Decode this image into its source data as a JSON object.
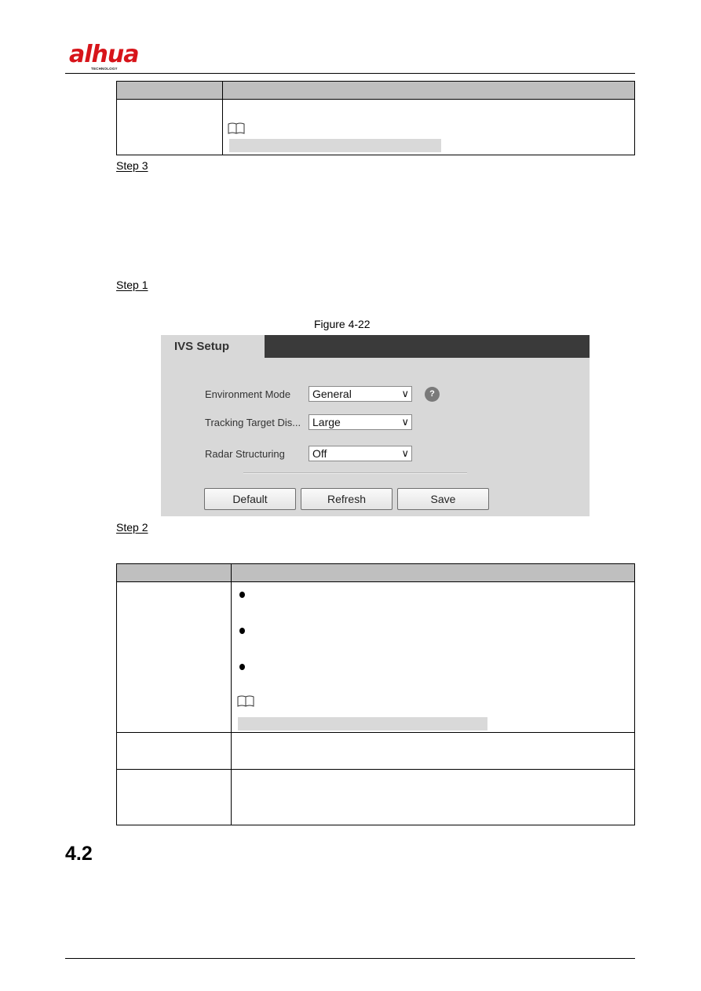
{
  "header": {
    "logo_text": "alhua",
    "logo_tagline": "TECHNOLOGY",
    "brand_color": "#d7141a"
  },
  "steps": {
    "step3": "Step 3",
    "step1": "Step 1",
    "step2": "Step 2"
  },
  "figure": {
    "caption": "Figure 4-22",
    "panel": {
      "tab_title": "IVS Setup",
      "fields": [
        {
          "label": "Environment Mode",
          "value": "General",
          "has_help": true
        },
        {
          "label": "Tracking Target Dis...",
          "value": "Large",
          "has_help": false
        },
        {
          "label": "Radar Structuring",
          "value": "Off",
          "has_help": false
        }
      ],
      "help_glyph": "?",
      "buttons": {
        "default": "Default",
        "refresh": "Refresh",
        "save": "Save"
      }
    }
  },
  "section": {
    "number": "4.2"
  },
  "icons": {
    "note": "book-note-icon",
    "bullet": "bullet-icon",
    "dropdown": "chevron-down-icon",
    "help": "question-circle-icon"
  },
  "dropdown_glyph": "∨"
}
